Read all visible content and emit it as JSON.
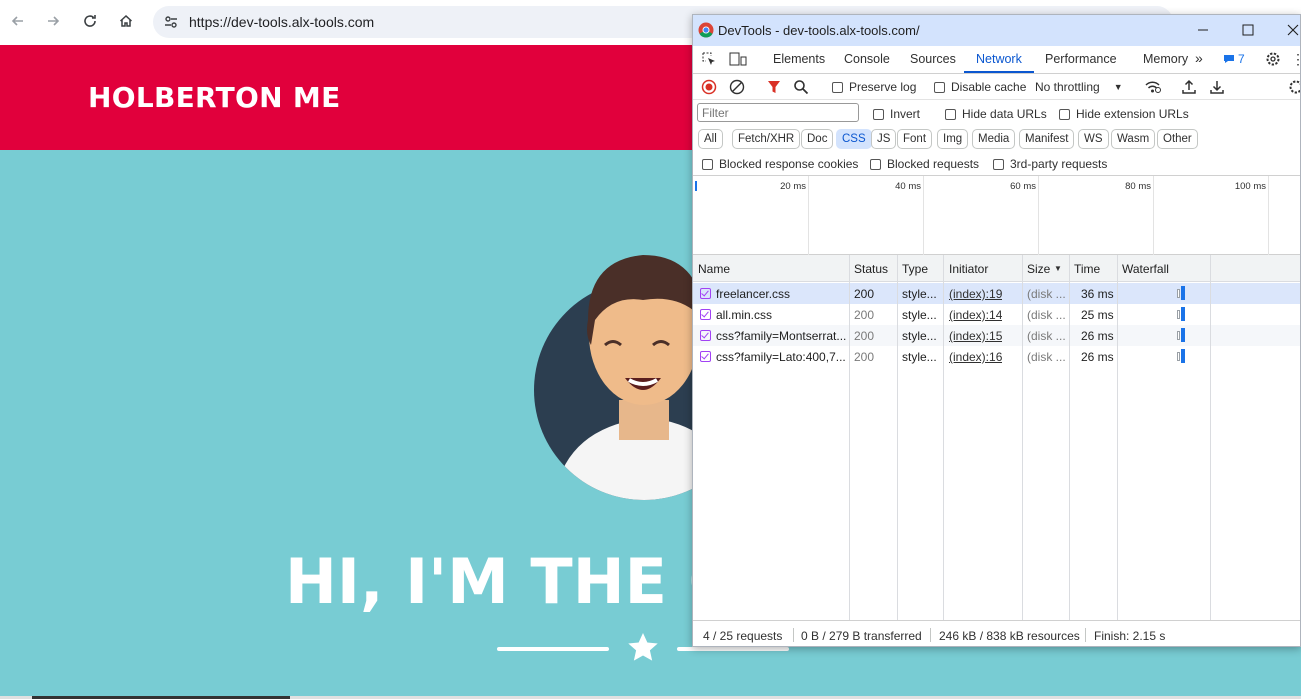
{
  "browser": {
    "url": "https://dev-tools.alx-tools.com"
  },
  "page": {
    "brand": "HOLBERTON ME",
    "hero_title": "HI, I'M THE C",
    "colors": {
      "header": "#e1003c",
      "hero": "#78ccd3"
    }
  },
  "devtools": {
    "title": "DevTools - dev-tools.alx-tools.com/",
    "tabs": [
      "Elements",
      "Console",
      "Sources",
      "Network",
      "Performance",
      "Memory"
    ],
    "active_tab": "Network",
    "issues_count": "7",
    "toolbar": {
      "preserve_log": "Preserve log",
      "disable_cache": "Disable cache",
      "throttling": "No throttling"
    },
    "filter": {
      "placeholder": "Filter",
      "invert": "Invert",
      "hide_data_urls": "Hide data URLs",
      "hide_extension_urls": "Hide extension URLs"
    },
    "types": [
      "All",
      "Fetch/XHR",
      "Doc",
      "CSS",
      "JS",
      "Font",
      "Img",
      "Media",
      "Manifest",
      "WS",
      "Wasm",
      "Other"
    ],
    "active_type": "CSS",
    "blocked": {
      "blocked_cookies": "Blocked response cookies",
      "blocked_requests": "Blocked requests",
      "third_party": "3rd-party requests"
    },
    "overview_ticks": [
      "20 ms",
      "40 ms",
      "60 ms",
      "80 ms",
      "100 ms"
    ],
    "columns": [
      "Name",
      "Status",
      "Type",
      "Initiator",
      "Size",
      "Time",
      "Waterfall"
    ],
    "rows": [
      {
        "name": "freelancer.css",
        "status": "200",
        "type": "style...",
        "initiator": "(index):19",
        "size": "(disk ...",
        "time": "36 ms"
      },
      {
        "name": "all.min.css",
        "status": "200",
        "type": "style...",
        "initiator": "(index):14",
        "size": "(disk ...",
        "time": "25 ms"
      },
      {
        "name": "css?family=Montserrat...",
        "status": "200",
        "type": "style...",
        "initiator": "(index):15",
        "size": "(disk ...",
        "time": "26 ms"
      },
      {
        "name": "css?family=Lato:400,7...",
        "status": "200",
        "type": "style...",
        "initiator": "(index):16",
        "size": "(disk ...",
        "time": "26 ms"
      }
    ],
    "status_bar": {
      "requests": "4 / 25 requests",
      "transferred": "0 B / 279 B transferred",
      "resources": "246 kB / 838 kB resources",
      "finish": "Finish: 2.15 s"
    }
  }
}
